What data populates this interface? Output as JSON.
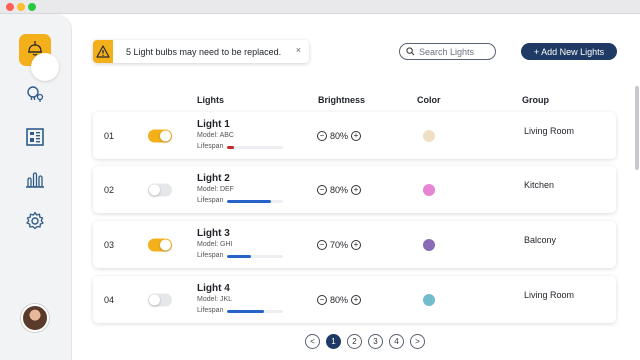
{
  "alert": {
    "message": "5 Light bulbs may need to be replaced.",
    "close": "×"
  },
  "search": {
    "placeholder": "Search Lights"
  },
  "toolbar": {
    "add_label": "+ Add New Lights"
  },
  "table": {
    "headers": {
      "lights": "Lights",
      "brightness": "Brightness",
      "color": "Color",
      "group": "Group"
    },
    "rows": [
      {
        "num": "01",
        "on": true,
        "name": "Light 1",
        "model": "Model: ABC",
        "lifespan_label": "Lifespan",
        "lifespan": 0.12,
        "lifespan_color": "#c62828",
        "brightness": "80%",
        "color": "#efe0c4",
        "group": "Living Room"
      },
      {
        "num": "02",
        "on": false,
        "name": "Light 2",
        "model": "Model: DEF",
        "lifespan_label": "Lifespan",
        "lifespan": 0.78,
        "lifespan_color": "#2563c9",
        "brightness": "80%",
        "color": "#e884d4",
        "group": "Kitchen"
      },
      {
        "num": "03",
        "on": true,
        "name": "Light 3",
        "model": "Model: GHI",
        "lifespan_label": "Lifespan",
        "lifespan": 0.42,
        "lifespan_color": "#2563c9",
        "brightness": "70%",
        "color": "#8a6bb8",
        "group": "Balcony"
      },
      {
        "num": "04",
        "on": false,
        "name": "Light 4",
        "model": "Model: JKL",
        "lifespan_label": "Lifespan",
        "lifespan": 0.66,
        "lifespan_color": "#2563c9",
        "brightness": "80%",
        "color": "#72bccd",
        "group": "Living Room"
      }
    ]
  },
  "stepper": {
    "minus": "−",
    "plus": "+"
  },
  "pagination": {
    "prev": "<",
    "next": ">",
    "pages": [
      "1",
      "2",
      "3",
      "4"
    ],
    "current": "1"
  },
  "colors": {
    "accent": "#f3b01a",
    "primary": "#1f3a64"
  },
  "icons": {
    "sidebar": [
      "lamp-icon",
      "bulbs-icon",
      "dashboard-icon",
      "chart-icon",
      "settings-icon"
    ],
    "alert": "warning-icon",
    "search": "search-icon"
  }
}
